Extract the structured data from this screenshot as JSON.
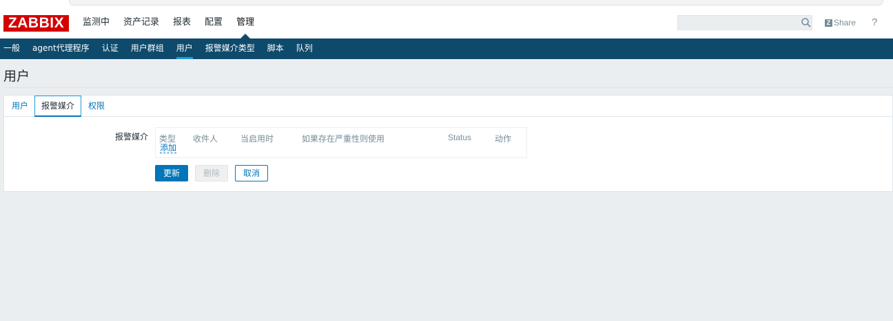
{
  "header": {
    "logo_text": "ZABBIX",
    "nav": [
      "监测中",
      "资产记录",
      "报表",
      "配置",
      "管理"
    ],
    "active_nav": "管理",
    "search": {
      "value": "",
      "placeholder": ""
    },
    "share_label": "Share",
    "help_label": "?"
  },
  "subnav": {
    "items": [
      "一般",
      "agent代理程序",
      "认证",
      "用户群组",
      "用户",
      "报警媒介类型",
      "脚本",
      "队列"
    ],
    "active": "用户"
  },
  "page": {
    "title": "用户"
  },
  "tabs": {
    "items": [
      "用户",
      "报警媒介",
      "权限"
    ],
    "active": "报警媒介"
  },
  "media": {
    "label": "报警媒介",
    "columns": [
      "类型",
      "收件人",
      "当启用时",
      "如果存在严重性则使用",
      "Status",
      "动作"
    ],
    "add_link": "添加"
  },
  "buttons": {
    "update": "更新",
    "delete": "删除",
    "cancel": "取消"
  },
  "colors": {
    "brand": "#d40000",
    "nav_bg": "#0e4a6b",
    "accent": "#0275b8",
    "page_bg": "#ebeef0"
  }
}
